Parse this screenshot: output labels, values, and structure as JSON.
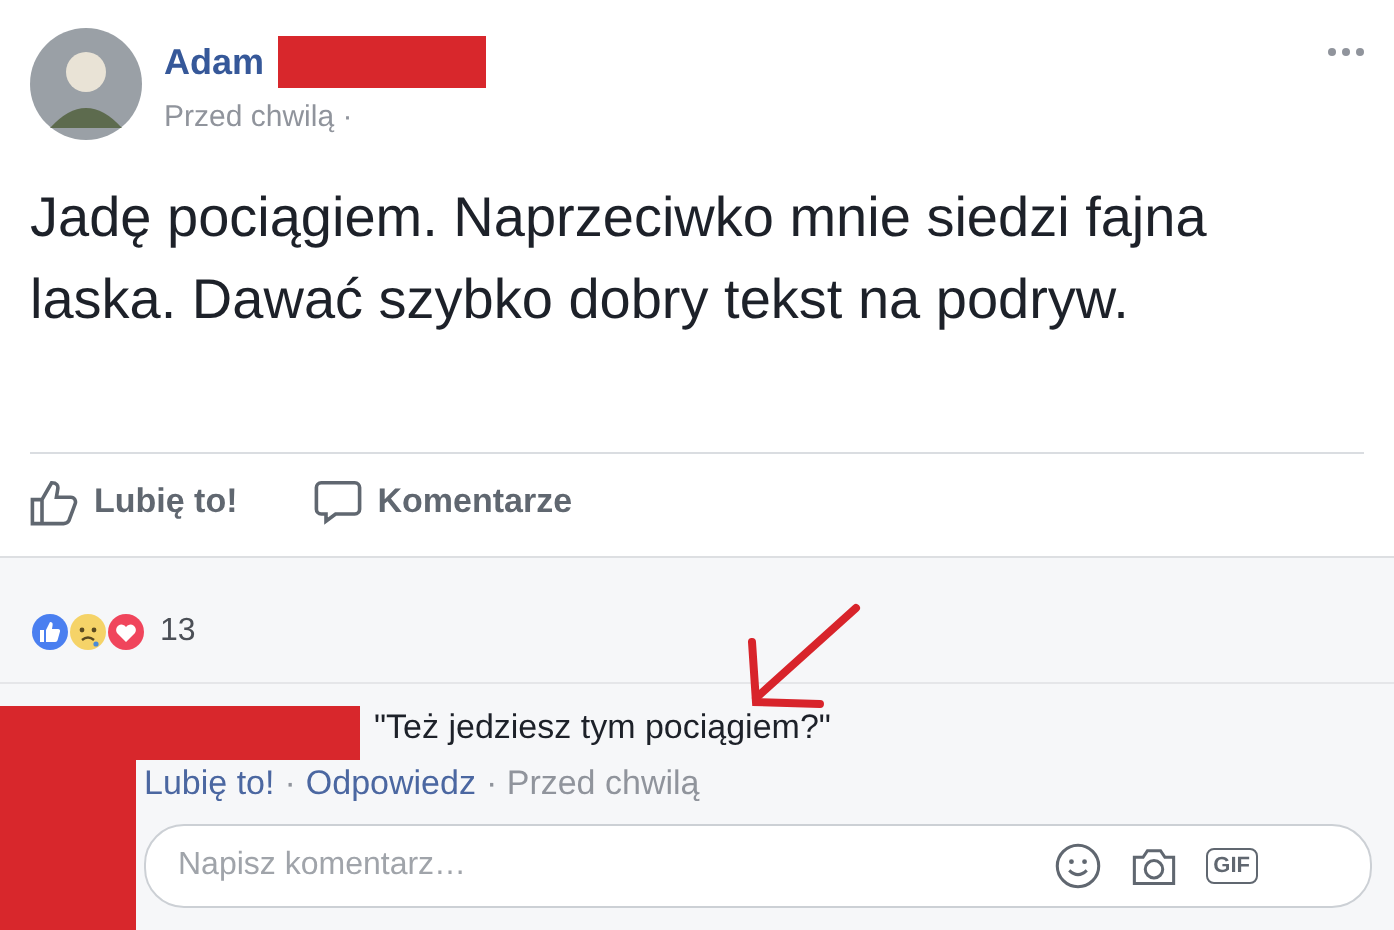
{
  "post": {
    "author": "Adam",
    "time": "Przed chwilą ·",
    "text": "Jadę pociągiem. Naprzeciwko mnie siedzi fajna laska. Dawać szybko dobry tekst na podryw.",
    "actions": [
      {
        "kind": "like",
        "label": "Lubię to!"
      },
      {
        "kind": "comment",
        "label": "Komentarze"
      }
    ]
  },
  "reactions": {
    "icons": [
      {
        "kind": "like"
      },
      {
        "kind": "sad"
      },
      {
        "kind": "love"
      }
    ],
    "count": "13"
  },
  "comment": {
    "text": "\"Też jedziesz tym pociągiem?\"",
    "like": "Lubię to!",
    "separator": "·",
    "reply": "Odpowiedz",
    "time": "· Przed chwilą"
  },
  "composer": {
    "placeholder": "Napisz komentarz…",
    "gif_label": "GIF"
  }
}
